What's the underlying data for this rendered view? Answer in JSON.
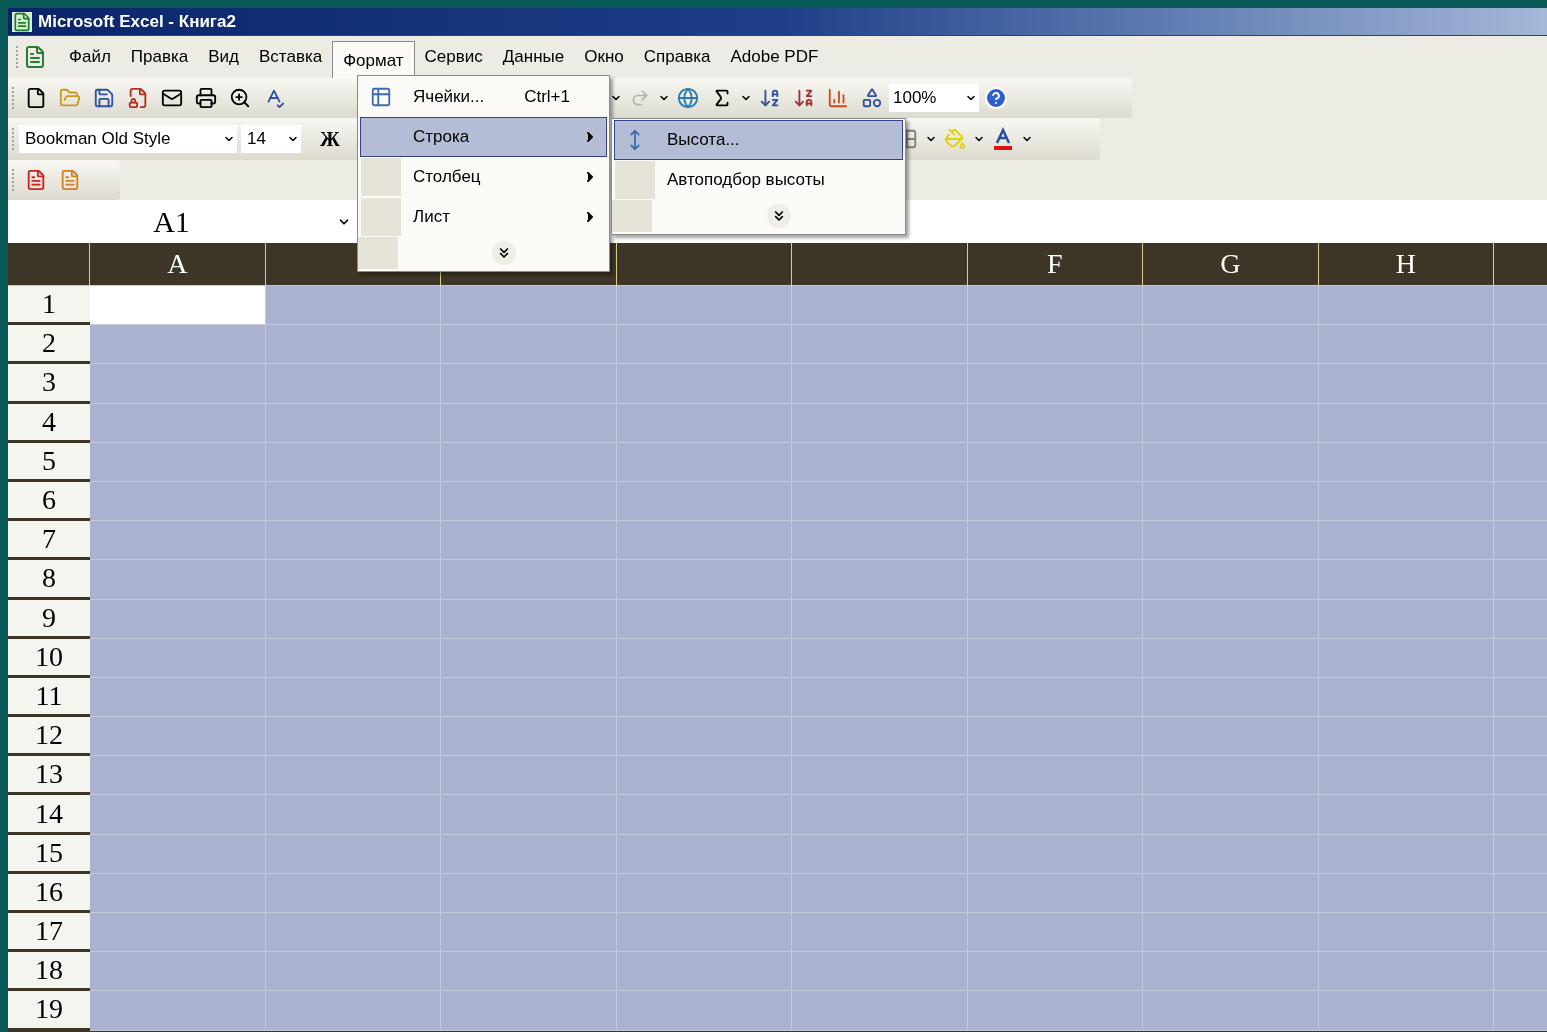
{
  "window": {
    "title": "Microsoft Excel - Книга2"
  },
  "menu_bar": [
    {
      "label": "Файл",
      "selected": false
    },
    {
      "label": "Правка",
      "selected": false
    },
    {
      "label": "Вид",
      "selected": false
    },
    {
      "label": "Вставка",
      "selected": false
    },
    {
      "label": "Формат",
      "selected": true
    },
    {
      "label": "Сервис",
      "selected": false
    },
    {
      "label": "Данные",
      "selected": false
    },
    {
      "label": "Окно",
      "selected": false
    },
    {
      "label": "Справка",
      "selected": false
    },
    {
      "label": "Adobe PDF",
      "selected": false
    }
  ],
  "standard_toolbar": {
    "zoom": "100%"
  },
  "formatting_toolbar": {
    "font": "Bookman Old Style",
    "size": "14",
    "bold": "Ж"
  },
  "name_box": "A1",
  "format_menu": [
    {
      "kind": "command",
      "label": "Ячейки...",
      "shortcut": "Ctrl+1",
      "selected": false
    },
    {
      "kind": "submenu",
      "label": "Строка",
      "selected": true
    },
    {
      "kind": "submenu",
      "label": "Столбец",
      "selected": false
    },
    {
      "kind": "submenu",
      "label": "Лист",
      "selected": false
    },
    {
      "kind": "expand",
      "selected": false
    }
  ],
  "row_submenu": [
    {
      "kind": "command",
      "label": "Высота...",
      "selected": true
    },
    {
      "kind": "command",
      "label": "Автоподбор высоты",
      "selected": false
    },
    {
      "kind": "expand",
      "selected": false
    }
  ],
  "sheet": {
    "columns": [
      {
        "label": "A"
      },
      {},
      {},
      {},
      {},
      {
        "label": "F"
      },
      {
        "label": "G"
      },
      {
        "label": "H"
      }
    ],
    "rows": [
      {
        "label": "1",
        "cells": [
          {
            "selected": true
          },
          {
            "selected": false
          },
          {
            "selected": false
          },
          {
            "selected": false
          },
          {
            "selected": false
          },
          {
            "selected": false
          },
          {
            "selected": false
          },
          {
            "selected": false
          }
        ]
      },
      {
        "label": "2",
        "cells": [
          {
            "selected": false
          },
          {
            "selected": false
          },
          {
            "selected": false
          },
          {
            "selected": false
          },
          {
            "selected": false
          },
          {
            "selected": false
          },
          {
            "selected": false
          },
          {
            "selected": false
          }
        ]
      },
      {
        "label": "3",
        "cells": [
          {
            "selected": false
          },
          {
            "selected": false
          },
          {
            "selected": false
          },
          {
            "selected": false
          },
          {
            "selected": false
          },
          {
            "selected": false
          },
          {
            "selected": false
          },
          {
            "selected": false
          }
        ]
      },
      {
        "label": "4",
        "cells": [
          {
            "selected": false
          },
          {
            "selected": false
          },
          {
            "selected": false
          },
          {
            "selected": false
          },
          {
            "selected": false
          },
          {
            "selected": false
          },
          {
            "selected": false
          },
          {
            "selected": false
          }
        ]
      },
      {
        "label": "5",
        "cells": [
          {
            "selected": false
          },
          {
            "selected": false
          },
          {
            "selected": false
          },
          {
            "selected": false
          },
          {
            "selected": false
          },
          {
            "selected": false
          },
          {
            "selected": false
          },
          {
            "selected": false
          }
        ]
      },
      {
        "label": "6",
        "cells": [
          {
            "selected": false
          },
          {
            "selected": false
          },
          {
            "selected": false
          },
          {
            "selected": false
          },
          {
            "selected": false
          },
          {
            "selected": false
          },
          {
            "selected": false
          },
          {
            "selected": false
          }
        ]
      },
      {
        "label": "7",
        "cells": [
          {
            "selected": false
          },
          {
            "selected": false
          },
          {
            "selected": false
          },
          {
            "selected": false
          },
          {
            "selected": false
          },
          {
            "selected": false
          },
          {
            "selected": false
          },
          {
            "selected": false
          }
        ]
      },
      {
        "label": "8",
        "cells": [
          {
            "selected": false
          },
          {
            "selected": false
          },
          {
            "selected": false
          },
          {
            "selected": false
          },
          {
            "selected": false
          },
          {
            "selected": false
          },
          {
            "selected": false
          },
          {
            "selected": false
          }
        ]
      },
      {
        "label": "9",
        "cells": [
          {
            "selected": false
          },
          {
            "selected": false
          },
          {
            "selected": false
          },
          {
            "selected": false
          },
          {
            "selected": false
          },
          {
            "selected": false
          },
          {
            "selected": false
          },
          {
            "selected": false
          }
        ]
      },
      {
        "label": "10",
        "cells": [
          {
            "selected": false
          },
          {
            "selected": false
          },
          {
            "selected": false
          },
          {
            "selected": false
          },
          {
            "selected": false
          },
          {
            "selected": false
          },
          {
            "selected": false
          },
          {
            "selected": false
          }
        ]
      },
      {
        "label": "11",
        "cells": [
          {
            "selected": false
          },
          {
            "selected": false
          },
          {
            "selected": false
          },
          {
            "selected": false
          },
          {
            "selected": false
          },
          {
            "selected": false
          },
          {
            "selected": false
          },
          {
            "selected": false
          }
        ]
      },
      {
        "label": "12",
        "cells": [
          {
            "selected": false
          },
          {
            "selected": false
          },
          {
            "selected": false
          },
          {
            "selected": false
          },
          {
            "selected": false
          },
          {
            "selected": false
          },
          {
            "selected": false
          },
          {
            "selected": false
          }
        ]
      },
      {
        "label": "13",
        "cells": [
          {
            "selected": false
          },
          {
            "selected": false
          },
          {
            "selected": false
          },
          {
            "selected": false
          },
          {
            "selected": false
          },
          {
            "selected": false
          },
          {
            "selected": false
          },
          {
            "selected": false
          }
        ]
      },
      {
        "label": "14",
        "cells": [
          {
            "selected": false
          },
          {
            "selected": false
          },
          {
            "selected": false
          },
          {
            "selected": false
          },
          {
            "selected": false
          },
          {
            "selected": false
          },
          {
            "selected": false
          },
          {
            "selected": false
          }
        ]
      },
      {
        "label": "15",
        "cells": [
          {
            "selected": false
          },
          {
            "selected": false
          },
          {
            "selected": false
          },
          {
            "selected": false
          },
          {
            "selected": false
          },
          {
            "selected": false
          },
          {
            "selected": false
          },
          {
            "selected": false
          }
        ]
      },
      {
        "label": "16",
        "cells": [
          {
            "selected": false
          },
          {
            "selected": false
          },
          {
            "selected": false
          },
          {
            "selected": false
          },
          {
            "selected": false
          },
          {
            "selected": false
          },
          {
            "selected": false
          },
          {
            "selected": false
          }
        ]
      },
      {
        "label": "17",
        "cells": [
          {
            "selected": false
          },
          {
            "selected": false
          },
          {
            "selected": false
          },
          {
            "selected": false
          },
          {
            "selected": false
          },
          {
            "selected": false
          },
          {
            "selected": false
          },
          {
            "selected": false
          }
        ]
      },
      {
        "label": "18",
        "cells": [
          {
            "selected": false
          },
          {
            "selected": false
          },
          {
            "selected": false
          },
          {
            "selected": false
          },
          {
            "selected": false
          },
          {
            "selected": false
          },
          {
            "selected": false
          },
          {
            "selected": false
          }
        ]
      },
      {
        "label": "19",
        "cells": [
          {
            "selected": false
          },
          {
            "selected": false
          },
          {
            "selected": false
          },
          {
            "selected": false
          },
          {
            "selected": false
          },
          {
            "selected": false
          },
          {
            "selected": false
          },
          {
            "selected": false
          }
        ]
      }
    ]
  }
}
